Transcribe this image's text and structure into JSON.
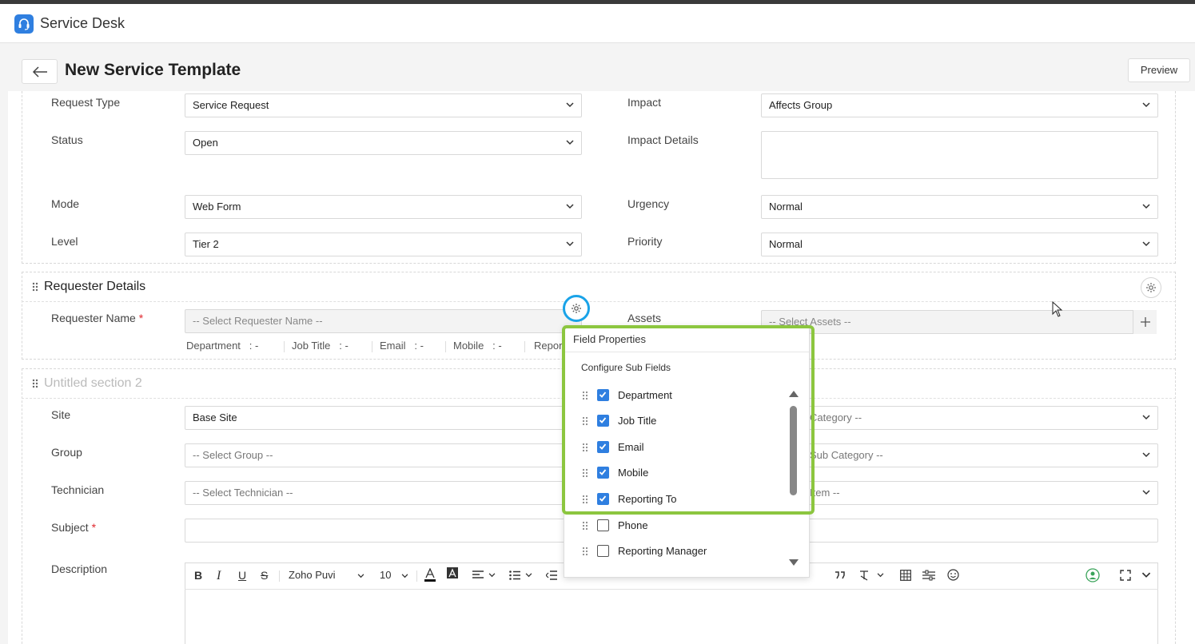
{
  "app": {
    "title": "Service Desk"
  },
  "page": {
    "title": "New Service Template",
    "preview_label": "Preview"
  },
  "section1": {
    "fields": {
      "request_type": {
        "label": "Request Type",
        "value": "Service Request"
      },
      "status": {
        "label": "Status",
        "value": "Open"
      },
      "mode": {
        "label": "Mode",
        "value": "Web Form"
      },
      "level": {
        "label": "Level",
        "value": "Tier 2"
      },
      "impact": {
        "label": "Impact",
        "value": "Affects Group"
      },
      "impact_details": {
        "label": "Impact Details",
        "value": ""
      },
      "urgency": {
        "label": "Urgency",
        "value": "Normal"
      },
      "priority": {
        "label": "Priority",
        "value": "Normal"
      }
    }
  },
  "requester": {
    "title": "Requester Details",
    "name_label": "Requester Name",
    "required_mark": "*",
    "name_placeholder": "-- Select Requester Name --",
    "assets_label": "Assets",
    "assets_placeholder": "-- Select Assets --",
    "subfields": [
      {
        "label": "Department",
        "value": ": -"
      },
      {
        "label": "Job Title",
        "value": ": -"
      },
      {
        "label": "Email",
        "value": ": -"
      },
      {
        "label": "Mobile",
        "value": ": -"
      },
      {
        "label": "Repor",
        "value": ""
      }
    ]
  },
  "section2": {
    "title": "Untitled section 2",
    "site": {
      "label": "Site",
      "value": "Base Site"
    },
    "group": {
      "label": "Group",
      "placeholder": "-- Select Group --"
    },
    "technician": {
      "label": "Technician",
      "placeholder": "-- Select Technician --"
    },
    "subject": {
      "label": "Subject",
      "value": ""
    },
    "description": {
      "label": "Description"
    },
    "category": {
      "placeholder": "Category --"
    },
    "subcategory": {
      "placeholder": "Sub Category --"
    },
    "item": {
      "placeholder": "Item --"
    }
  },
  "editor": {
    "font": "Zoho Puvi",
    "size": "10"
  },
  "popup": {
    "title": "Field Properties",
    "subtitle": "Configure Sub Fields",
    "items": [
      {
        "label": "Department",
        "checked": true
      },
      {
        "label": "Job Title",
        "checked": true
      },
      {
        "label": "Email",
        "checked": true
      },
      {
        "label": "Mobile",
        "checked": true
      },
      {
        "label": "Reporting To",
        "checked": true
      },
      {
        "label": "Phone",
        "checked": false
      },
      {
        "label": "Reporting Manager",
        "checked": false
      }
    ]
  },
  "colors": {
    "accent": "#2f7fe0",
    "highlight_green": "#8cc63f",
    "highlight_blue": "#1aa3e8"
  }
}
